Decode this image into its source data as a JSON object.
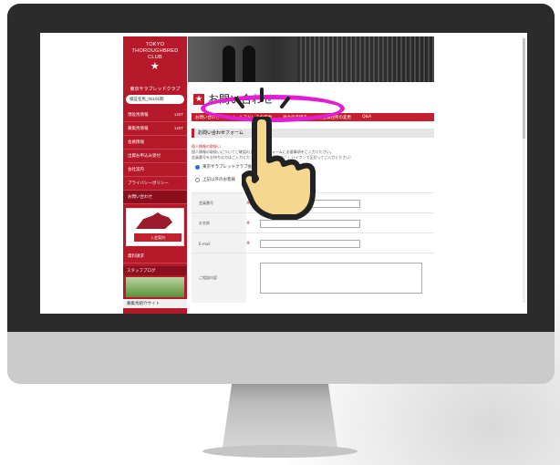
{
  "site": {
    "logo_text": [
      "TOKYO",
      "THOROUGHBRED",
      "CLUB"
    ],
    "logo_star": "★",
    "club_name": "東京サラブレッドクラブ",
    "search_label": "検証名馬_00101期",
    "menu": [
      {
        "label": "現役馬情報",
        "badge": "LIST"
      },
      {
        "label": "募集馬情報",
        "badge": "LIST"
      },
      {
        "label": "会員情報",
        "badge": ""
      },
      {
        "label": "出資お申込み受付",
        "badge": ""
      },
      {
        "label": "会社案内",
        "badge": ""
      },
      {
        "label": "プライバシーポリシー",
        "badge": ""
      },
      {
        "label": "お問い合わせ",
        "badge": ""
      }
    ],
    "banner_label": "入会案内",
    "doc_label": "資料請求",
    "blog_label": "スタッフブログ",
    "bottom_link": "募集馬紹介サイト"
  },
  "page": {
    "title_icon": "★",
    "title": "お問い合わせ",
    "tabs": [
      "お問い合わせ",
      "メールアドレスの変更",
      "退会の手続き",
      "ご登録住所の変更",
      "Q&A"
    ],
    "section_title": "お問い合わせフォーム",
    "notice_link": "個人情報の取扱い",
    "notice_line1": "個人情報の取扱いについてご確認の上、下記のフォームに必要事項をご入力ください。",
    "notice_line2": "会員番号をお持ちの方はご入力ください。（電話番号は「-」ハイフンで区切ってご入力ください）",
    "radio_member": "東京サラブレッドクラブ会員様",
    "radio_nonmember": "上記以外のお客様",
    "fields": [
      {
        "label": "会員番号",
        "required": "※"
      },
      {
        "label": "お名前",
        "required": "※"
      },
      {
        "label": "E-mail",
        "required": "※"
      },
      {
        "label": "ご相談内容",
        "required": ""
      }
    ]
  },
  "overlay": {
    "highlight_color": "#e21ed0",
    "icon": "pointing-hand-icon"
  }
}
